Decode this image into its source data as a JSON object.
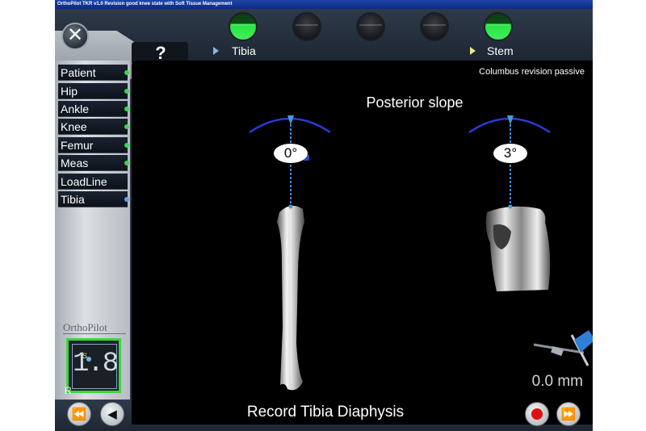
{
  "window": {
    "title": "OrthoPilot TKR v1.0 Revision good knee state with Soft Tissue Management"
  },
  "toolbar": {
    "close_glyph": "✕",
    "help_label": "?"
  },
  "workflow": {
    "steps": [
      {
        "state": "done",
        "label": "Tibia"
      },
      {
        "state": "todo",
        "label": ""
      },
      {
        "state": "todo",
        "label": ""
      },
      {
        "state": "todo",
        "label": ""
      },
      {
        "state": "done",
        "label": "Stem"
      }
    ]
  },
  "sidebar": {
    "items": [
      {
        "label": "Patient",
        "status": "green"
      },
      {
        "label": "Hip",
        "status": "green"
      },
      {
        "label": "Ankle",
        "status": "green"
      },
      {
        "label": "Knee",
        "status": "green"
      },
      {
        "label": "Femur",
        "status": "green"
      },
      {
        "label": "Meas",
        "status": "green"
      },
      {
        "label": "LoadLine",
        "status": ""
      },
      {
        "label": "Tibia",
        "status": "blue"
      }
    ],
    "brand": "OrthoPilot",
    "sensor": {
      "value": "1.8",
      "marker": "S"
    },
    "side": "R"
  },
  "view": {
    "mode": "Columbus revision passive",
    "title": "Posterior slope",
    "left_angle": "0°",
    "right_angle": "3°",
    "distance": "0.0 mm"
  },
  "footer": {
    "status": "Record Tibia Diaphysis",
    "back_all_glyph": "⏪",
    "back_glyph": "◀",
    "forward_glyph": "⏩"
  },
  "colors": {
    "accent_green": "#3bd64a",
    "arc_blue": "#2a3bd6",
    "record_red": "#e01010"
  }
}
